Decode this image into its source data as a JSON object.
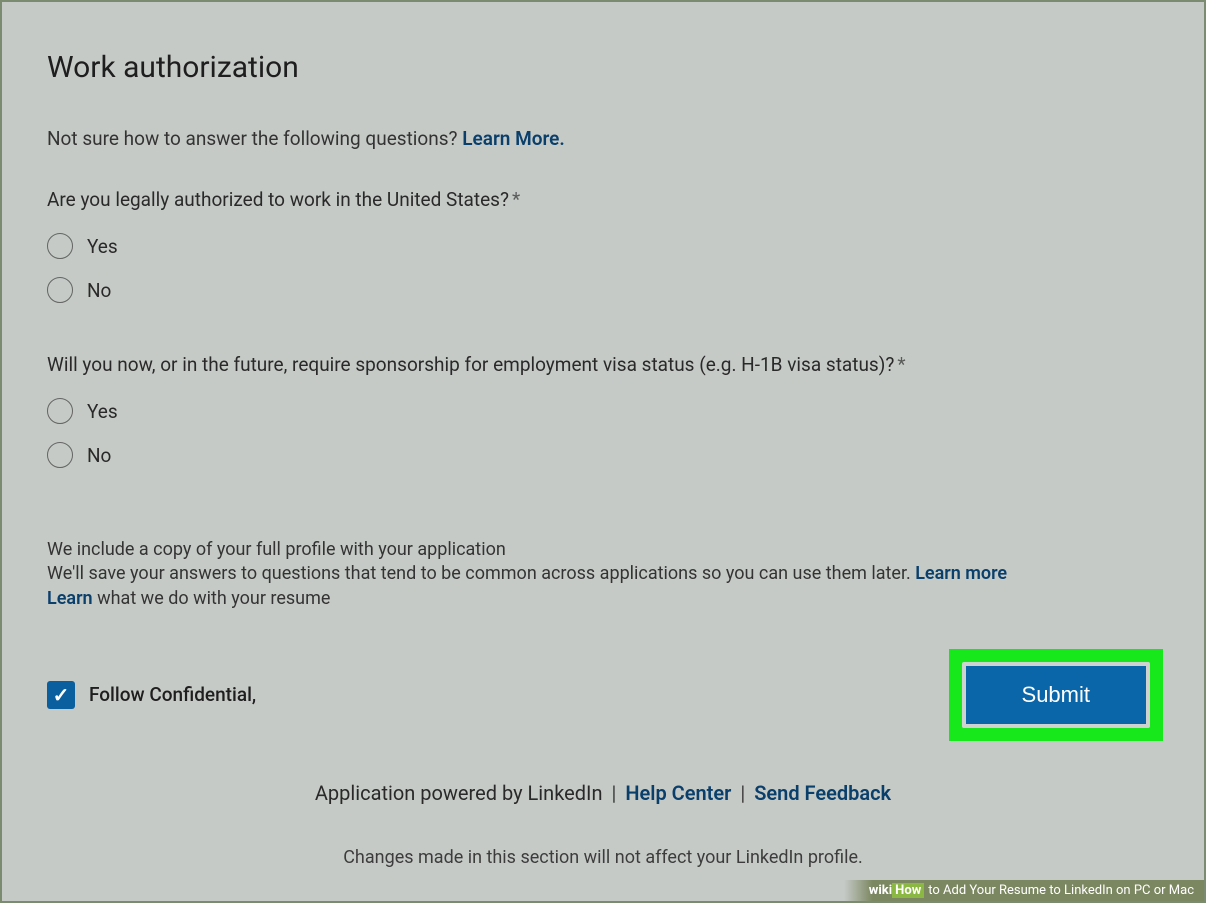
{
  "title": "Work authorization",
  "help": {
    "text": "Not sure how to answer the following questions? ",
    "link": "Learn More."
  },
  "questions": [
    {
      "label": "Are you legally authorized to work in the United States?",
      "required": "*",
      "options": [
        "Yes",
        "No"
      ]
    },
    {
      "label": "Will you now, or in the future, require sponsorship for employment visa status (e.g. H-1B visa status)?",
      "required": "*",
      "options": [
        "Yes",
        "No"
      ]
    }
  ],
  "info": {
    "line1": "We include a copy of your full profile with your application",
    "line2_prefix": "We'll save your answers to questions that tend to be common across applications so you can use them later. ",
    "learn_more": "Learn more",
    "line3_link": "Learn",
    "line3_suffix": " what we do with your resume"
  },
  "checkbox": {
    "label": "Follow Confidential,",
    "checked": true
  },
  "submit": "Submit",
  "footer": {
    "prefix": "Application powered by LinkedIn ",
    "help_center": "Help Center",
    "send_feedback": "Send Feedback"
  },
  "footer_note": "Changes made in this section will not affect your LinkedIn profile.",
  "watermark": {
    "logo": "wiki",
    "how": "How",
    "text": " to Add Your Resume to LinkedIn on PC or Mac"
  }
}
